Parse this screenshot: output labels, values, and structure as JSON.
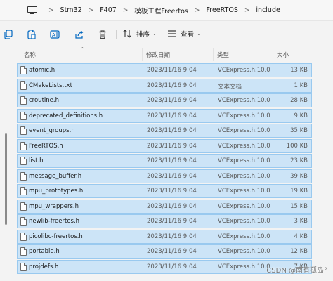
{
  "breadcrumb": {
    "segments": [
      "Stm32",
      "F407",
      "模板工程Freertos",
      "FreeRTOS",
      "include"
    ],
    "chevron": ">"
  },
  "toolbar": {
    "sort_label": "排序",
    "view_label": "查看",
    "icons": [
      "copy-icon",
      "paste-icon",
      "rename-icon",
      "share-icon",
      "delete-icon",
      "sort-icon",
      "view-icon"
    ]
  },
  "columns": {
    "name": "名称",
    "date": "修改日期",
    "type": "类型",
    "size": "大小"
  },
  "files": [
    {
      "name": "atomic.h",
      "date": "2023/11/16 9:04",
      "type": "VCExpress.h.10.0",
      "size": "13 KB"
    },
    {
      "name": "CMakeLists.txt",
      "date": "2023/11/16 9:04",
      "type": "文本文档",
      "size": "1 KB"
    },
    {
      "name": "croutine.h",
      "date": "2023/11/16 9:04",
      "type": "VCExpress.h.10.0",
      "size": "28 KB"
    },
    {
      "name": "deprecated_definitions.h",
      "date": "2023/11/16 9:04",
      "type": "VCExpress.h.10.0",
      "size": "9 KB"
    },
    {
      "name": "event_groups.h",
      "date": "2023/11/16 9:04",
      "type": "VCExpress.h.10.0",
      "size": "35 KB"
    },
    {
      "name": "FreeRTOS.h",
      "date": "2023/11/16 9:04",
      "type": "VCExpress.h.10.0",
      "size": "100 KB"
    },
    {
      "name": "list.h",
      "date": "2023/11/16 9:04",
      "type": "VCExpress.h.10.0",
      "size": "23 KB"
    },
    {
      "name": "message_buffer.h",
      "date": "2023/11/16 9:04",
      "type": "VCExpress.h.10.0",
      "size": "39 KB"
    },
    {
      "name": "mpu_prototypes.h",
      "date": "2023/11/16 9:04",
      "type": "VCExpress.h.10.0",
      "size": "19 KB"
    },
    {
      "name": "mpu_wrappers.h",
      "date": "2023/11/16 9:04",
      "type": "VCExpress.h.10.0",
      "size": "15 KB"
    },
    {
      "name": "newlib-freertos.h",
      "date": "2023/11/16 9:04",
      "type": "VCExpress.h.10.0",
      "size": "3 KB"
    },
    {
      "name": "picolibc-freertos.h",
      "date": "2023/11/16 9:04",
      "type": "VCExpress.h.10.0",
      "size": "4 KB"
    },
    {
      "name": "portable.h",
      "date": "2023/11/16 9:04",
      "type": "VCExpress.h.10.0",
      "size": "12 KB"
    },
    {
      "name": "projdefs.h",
      "date": "2023/11/16 9:04",
      "type": "VCExpress.h.10.0",
      "size": "7 KB"
    }
  ],
  "watermark": "CSDN @南有孤岛°",
  "colors": {
    "selection": "#cce4f7",
    "selection_border": "#99c9ef"
  }
}
